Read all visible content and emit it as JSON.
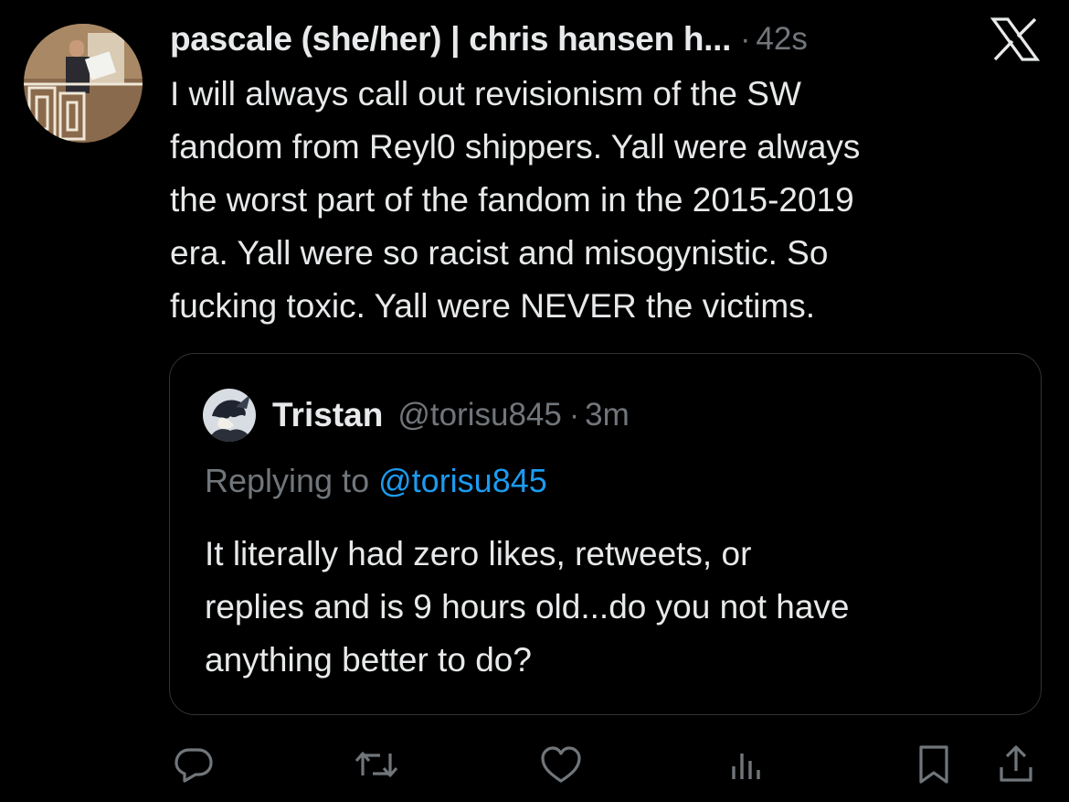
{
  "tweet": {
    "author": {
      "display_name": "pascale (she/her) | chris hansen h...",
      "avatar_icon": "profile-photo"
    },
    "separator": "·",
    "timestamp": "42s",
    "text": "I will always call out revisionism of the SW\nfandom from Reyl0 shippers. Yall were always\nthe worst part of the fandom in the 2015-2019\nera. Yall were so racist and misogynistic. So\nfucking toxic. Yall were NEVER the victims.",
    "platform_icon": "x-logo-icon"
  },
  "quote": {
    "author": {
      "display_name": "Tristan",
      "handle": "@torisu845",
      "avatar_icon": "profile-photo"
    },
    "separator": "·",
    "timestamp": "3m",
    "replying_label": "Replying to",
    "replying_handle": "@torisu845",
    "text": "It literally had zero likes, retweets, or\nreplies and is 9 hours old...do you not have\nanything better to do?"
  },
  "actions": [
    {
      "name": "reply",
      "icon": "reply-icon"
    },
    {
      "name": "retweet",
      "icon": "retweet-icon"
    },
    {
      "name": "like",
      "icon": "heart-icon"
    },
    {
      "name": "views",
      "icon": "views-icon"
    },
    {
      "name": "bookmark",
      "icon": "bookmark-icon"
    },
    {
      "name": "share",
      "icon": "share-icon"
    }
  ],
  "colors": {
    "background": "#000000",
    "text_primary": "#e7e9ea",
    "text_secondary": "#71767b",
    "link": "#1d9bf0",
    "border": "#2f3336"
  }
}
